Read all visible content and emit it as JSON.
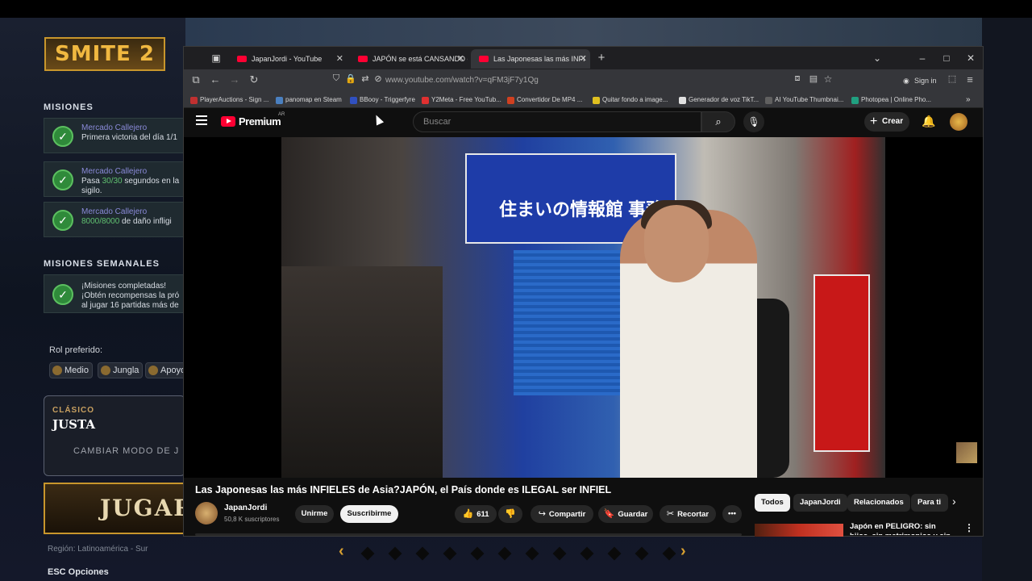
{
  "game": {
    "logo": "SMITE 2",
    "missions_title": "MISIONES",
    "missions": [
      {
        "title": "Mercado Callejero",
        "desc": "Primera victoria del día 1/1"
      },
      {
        "title": "Mercado Callejero",
        "desc_a": "Pasa ",
        "desc_hl": "30/30",
        "desc_b": " segundos en la",
        "desc2": "sigilo."
      },
      {
        "title": "Mercado Callejero",
        "desc_hl": "8000/8000",
        "desc_b": " de daño infligi"
      }
    ],
    "weekly_title": "MISIONES SEMANALES",
    "weekly": {
      "title": "¡Misiones completadas!",
      "desc": "¡Obtén recompensas la pró",
      "desc2": "al jugar 16 partidas más de"
    },
    "rol_label": "Rol preferido:",
    "roles": [
      "Medio",
      "Jungla",
      "Apoyo"
    ],
    "mode": {
      "category": "CLÁSICO",
      "name": "JUSTA",
      "change": "CAMBIAR MODO DE J"
    },
    "play": "JUGAR",
    "region": "Región: Latinoamérica - Sur",
    "esc": "ESC  Opciones"
  },
  "browser": {
    "tabs": [
      {
        "label": "JapanJordi - YouTube",
        "active": false
      },
      {
        "label": "JAPÓN se está CANSANDO de |",
        "active": false
      },
      {
        "label": "Las Japonesas las más INFI",
        "active": true
      }
    ],
    "url": "www.youtube.com/watch?v=qFM3jF7y1Qg",
    "sign_in": "Sign in",
    "bookmarks": [
      {
        "label": "PlayerAuctions - Sign ...",
        "color": "#c03030"
      },
      {
        "label": "panomap en Steam",
        "color": "#4a80c0"
      },
      {
        "label": "BBooy - Triggerfyre",
        "color": "#3050c0"
      },
      {
        "label": "Y2Meta - Free YouTub...",
        "color": "#e03030"
      },
      {
        "label": "Convertidor De MP4 ...",
        "color": "#d04020"
      },
      {
        "label": "Quitar fondo a image...",
        "color": "#e0c020"
      },
      {
        "label": "Generador de voz TikT...",
        "color": "#e0e0e0"
      },
      {
        "label": "AI YouTube Thumbnai...",
        "color": "#202020"
      },
      {
        "label": "Photopea | Online Pho...",
        "color": "#20a080"
      }
    ]
  },
  "youtube": {
    "brand": "Premium",
    "region_code": "AR",
    "search_placeholder": "Buscar",
    "create": "Crear",
    "video_title": "Las Japonesas las más INFIELES de Asia?JAPÓN, el País donde es ILEGAL ser INFIEL",
    "sign_text": "住まいの情報館 事務所",
    "channel": {
      "name": "JapanJordi",
      "subs": "50,8 K suscriptores"
    },
    "join": "Unirme",
    "subscribe": "Suscribirme",
    "likes": "611",
    "share": "Compartir",
    "save": "Guardar",
    "clip": "Recortar",
    "chips": [
      "Todos",
      "JapanJordi",
      "Relacionados",
      "Para ti"
    ],
    "rec_title": "Japón en PELIGRO: sin hijos, sin matrimonios y sin"
  }
}
